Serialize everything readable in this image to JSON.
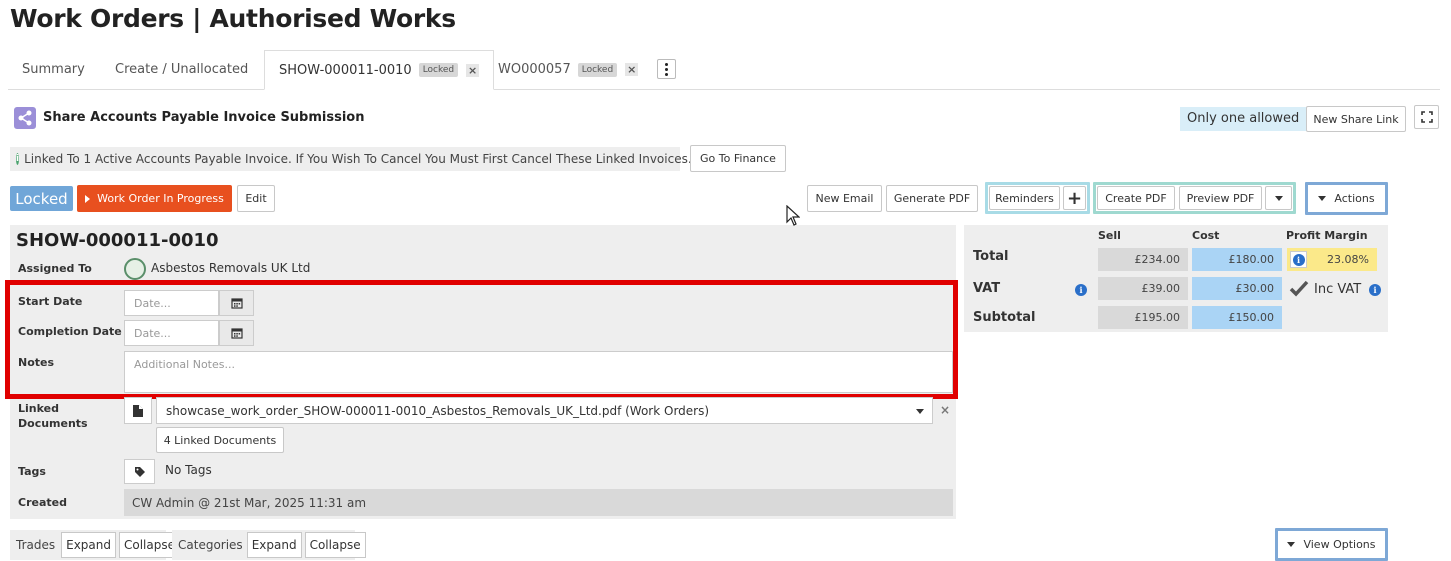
{
  "page": {
    "title": "Work Orders | Authorised Works"
  },
  "tabs": [
    {
      "label": "Summary"
    },
    {
      "label": "Create / Unallocated"
    },
    {
      "label": "SHOW-000011-0010",
      "badge": "Locked",
      "close": "×"
    },
    {
      "label": "WO000057",
      "badge": "Locked",
      "close": "×"
    }
  ],
  "share": {
    "title": "Share Accounts Payable Invoice Submission",
    "only_one": "Only one allowed",
    "new_link": "New Share Link"
  },
  "notice": {
    "icon": "i",
    "text": "Linked To 1 Active Accounts Payable Invoice. If You Wish To Cancel You Must First Cancel These Linked Invoices.",
    "button": "Go To Finance"
  },
  "status": {
    "locked": "Locked",
    "progress": "Work Order In Progress",
    "edit": "Edit"
  },
  "toolbar": {
    "new_email": "New Email",
    "generate_pdf": "Generate PDF",
    "reminders": "Reminders",
    "plus": "+",
    "create_pdf": "Create PDF",
    "preview_pdf": "Preview PDF",
    "actions": "Actions"
  },
  "work_order": {
    "id": "SHOW-000011-0010",
    "assigned_to_label": "Assigned To",
    "assigned_to": "Asbestos Removals UK Ltd",
    "start_date_label": "Start Date",
    "start_date_placeholder": "Date...",
    "completion_date_label": "Completion Date",
    "completion_date_placeholder": "Date...",
    "notes_label": "Notes",
    "notes_placeholder": "Additional Notes...",
    "linked_docs_label": "Linked Documents",
    "linked_doc_value": "showcase_work_order_SHOW-000011-0010_Asbestos_Removals_UK_Ltd.pdf (Work Orders)",
    "remove": "×",
    "linked_docs_count": "4 Linked Documents",
    "tags_label": "Tags",
    "tags_value": "No Tags",
    "created_label": "Created",
    "created_value": "CW Admin @ 21st Mar, 2025 11:31 am"
  },
  "financials": {
    "headers": {
      "sell": "Sell",
      "cost": "Cost",
      "margin": "Profit Margin"
    },
    "total": {
      "label": "Total",
      "sell": "£234.00",
      "cost": "£180.00",
      "margin": "23.08%"
    },
    "vat": {
      "label": "VAT",
      "sell": "£39.00",
      "cost": "£30.00",
      "inc_vat": "Inc VAT"
    },
    "subtotal": {
      "label": "Subtotal",
      "sell": "£195.00",
      "cost": "£150.00"
    },
    "info_icon": "i"
  },
  "bottom": {
    "trades": "Trades",
    "categories": "Categories",
    "expand": "Expand",
    "collapse": "Collapse",
    "view_options": "View Options"
  },
  "colors": {
    "locked_blue": "#70a6d8",
    "progress_orange": "#e8501f",
    "highlight_red": "#e00000",
    "cost_blue": "#aad4f5",
    "margin_yellow": "#fbe98a",
    "group_cyan": "#a8dbe6",
    "group_teal": "#9fd9d0",
    "group_blue": "#7ea8d6"
  }
}
